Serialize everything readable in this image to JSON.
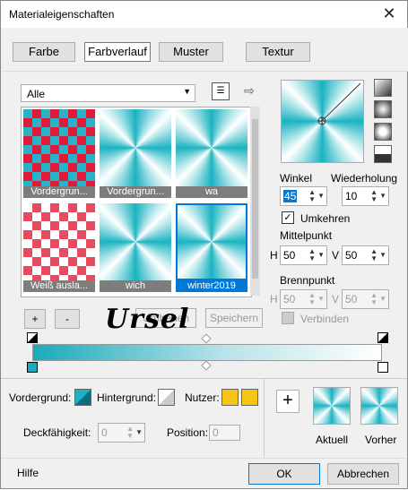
{
  "window": {
    "title": "Materialeigenschaften",
    "close_glyph": "✕"
  },
  "tabs": [
    {
      "label": "Farbe",
      "active": false
    },
    {
      "label": "Farbverlauf",
      "active": true
    },
    {
      "label": "Muster",
      "active": false
    },
    {
      "label": "Textur",
      "active": false
    }
  ],
  "category_select": {
    "value": "Alle"
  },
  "gradients": [
    {
      "label": "Vordergrun...",
      "style": "checker"
    },
    {
      "label": "Vordergrun...",
      "style": "sunburst"
    },
    {
      "label": "wa",
      "style": "sunburst"
    },
    {
      "label": "Weiß ausla...",
      "style": "checker-red"
    },
    {
      "label": "wich",
      "style": "sunburst"
    },
    {
      "label": "winter2019",
      "style": "sunburst",
      "selected": true
    }
  ],
  "settings": {
    "winkel_label": "Winkel",
    "winkel_value": "45",
    "wiederholung_label": "Wiederholung",
    "wiederholung_value": "10",
    "umkehren_label": "Umkehren",
    "umkehren_checked": true,
    "mittelpunkt_label": "Mittelpunkt",
    "mittel_h_label": "H",
    "mittel_h_value": "50",
    "mittel_v_label": "V",
    "mittel_v_value": "50",
    "brennpunkt_label": "Brennpunkt",
    "brenn_h_label": "H",
    "brenn_h_value": "50",
    "brenn_v_label": "V",
    "brenn_v_value": "50",
    "verbinden_label": "Verbinden"
  },
  "actions": {
    "add": "+",
    "remove": "-",
    "umbenennen": "Umbenen",
    "speichern": "Speichern"
  },
  "watermark": "Ursel",
  "lower": {
    "vordergrund_label": "Vordergrund:",
    "hintergrund_label": "Hintergrund:",
    "nutzer_label": "Nutzer:",
    "nutzer_color": "#f5c518",
    "deckfaehigkeit_label": "Deckfähigkeit:",
    "deckfaehigkeit_value": "0",
    "position_label": "Position:",
    "position_value": "0",
    "add_glyph": "+",
    "aktuell_label": "Aktuell",
    "vorher_label": "Vorher"
  },
  "footer": {
    "hilfe": "Hilfe",
    "ok": "OK",
    "abbrechen": "Abbrechen"
  }
}
